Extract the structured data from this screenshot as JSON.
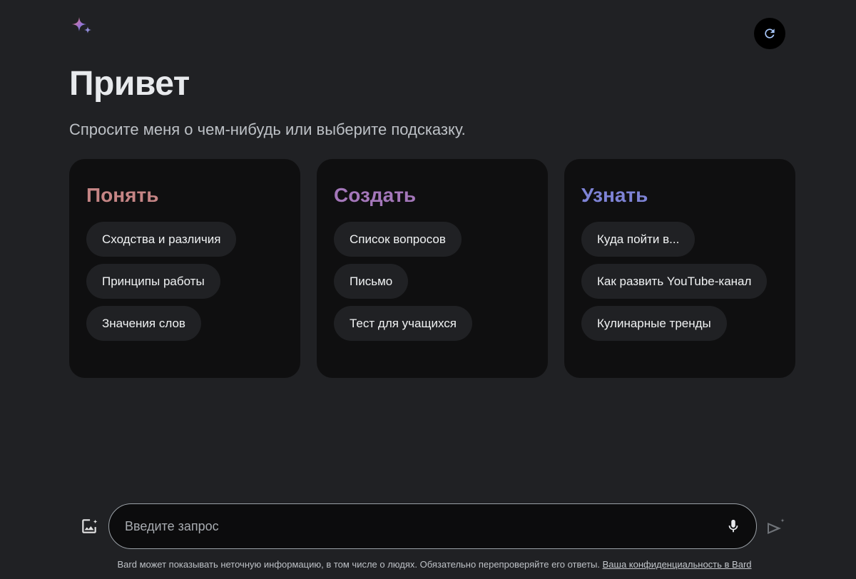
{
  "header": {
    "logo_icon": "bard-sparkle-icon",
    "refresh_icon": "refresh-icon"
  },
  "hero": {
    "greeting": "Привет",
    "subtitle": "Спросите меня о чем-нибудь или выберите подсказку."
  },
  "cards": [
    {
      "title": "Понять",
      "title_color": "#c58585",
      "chips": [
        "Сходства и различия",
        "Принципы работы",
        "Значения слов"
      ]
    },
    {
      "title": "Создать",
      "title_color": "#a477ba",
      "chips": [
        "Список вопросов",
        "Письмо",
        "Тест для учащихся"
      ]
    },
    {
      "title": "Узнать",
      "title_color": "#7e83d6",
      "chips": [
        "Куда пойти в...",
        "Как развить YouTube-канал",
        "Кулинарные тренды"
      ]
    }
  ],
  "prompt": {
    "placeholder": "Введите запрос",
    "value": "",
    "image_icon": "add-image-icon",
    "mic_icon": "microphone-icon",
    "send_icon": "send-icon"
  },
  "footer": {
    "disclaimer": "Bard может показывать неточную информацию, в том числе о людях. Обязательно перепроверяйте его ответы.",
    "privacy_link": "Ваша конфиденциальность в Bard"
  }
}
